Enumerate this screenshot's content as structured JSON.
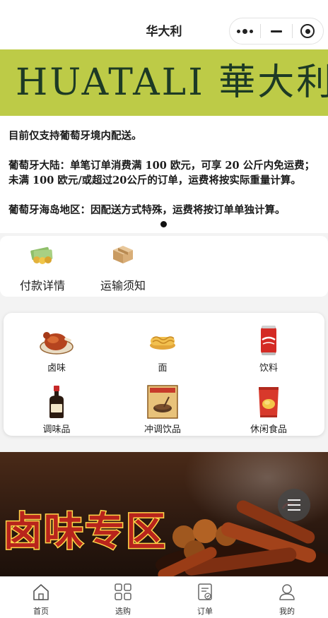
{
  "navbar": {
    "title": "华大利"
  },
  "banner": {
    "text": "HUATALI 華大利"
  },
  "notice": {
    "line1": "目前仅支持葡萄牙境内配送。",
    "line2": "葡萄牙大陆：单笔订单消费满 100 欧元，可享 20 公斤内免运费；未满 100 欧元/或超过20公斤的订单，运费将按实际重量计算。",
    "line3": "葡萄牙海岛地区：因配送方式特殊，运费将按订单单独计算。"
  },
  "info": [
    {
      "label": "付款详情",
      "icon": "money-icon"
    },
    {
      "label": "运输须知",
      "icon": "package-icon"
    }
  ],
  "categories": [
    {
      "label": "卤味",
      "icon": "roast-duck-icon"
    },
    {
      "label": "面",
      "icon": "noodles-icon"
    },
    {
      "label": "饮料",
      "icon": "cola-can-icon"
    },
    {
      "label": "调味品",
      "icon": "soy-sauce-icon"
    },
    {
      "label": "冲调饮品",
      "icon": "sesame-paste-icon"
    },
    {
      "label": "休闲食品",
      "icon": "chips-bag-icon"
    }
  ],
  "promo": {
    "title": "卤味专区"
  },
  "tabbar": [
    {
      "label": "首页",
      "icon": "home-icon"
    },
    {
      "label": "选购",
      "icon": "grid-icon"
    },
    {
      "label": "订单",
      "icon": "order-icon"
    },
    {
      "label": "我的",
      "icon": "user-icon"
    }
  ],
  "colors": {
    "banner_bg": "#bdcb47",
    "banner_text": "#1d3a25",
    "promo_title": "#b8241c"
  }
}
